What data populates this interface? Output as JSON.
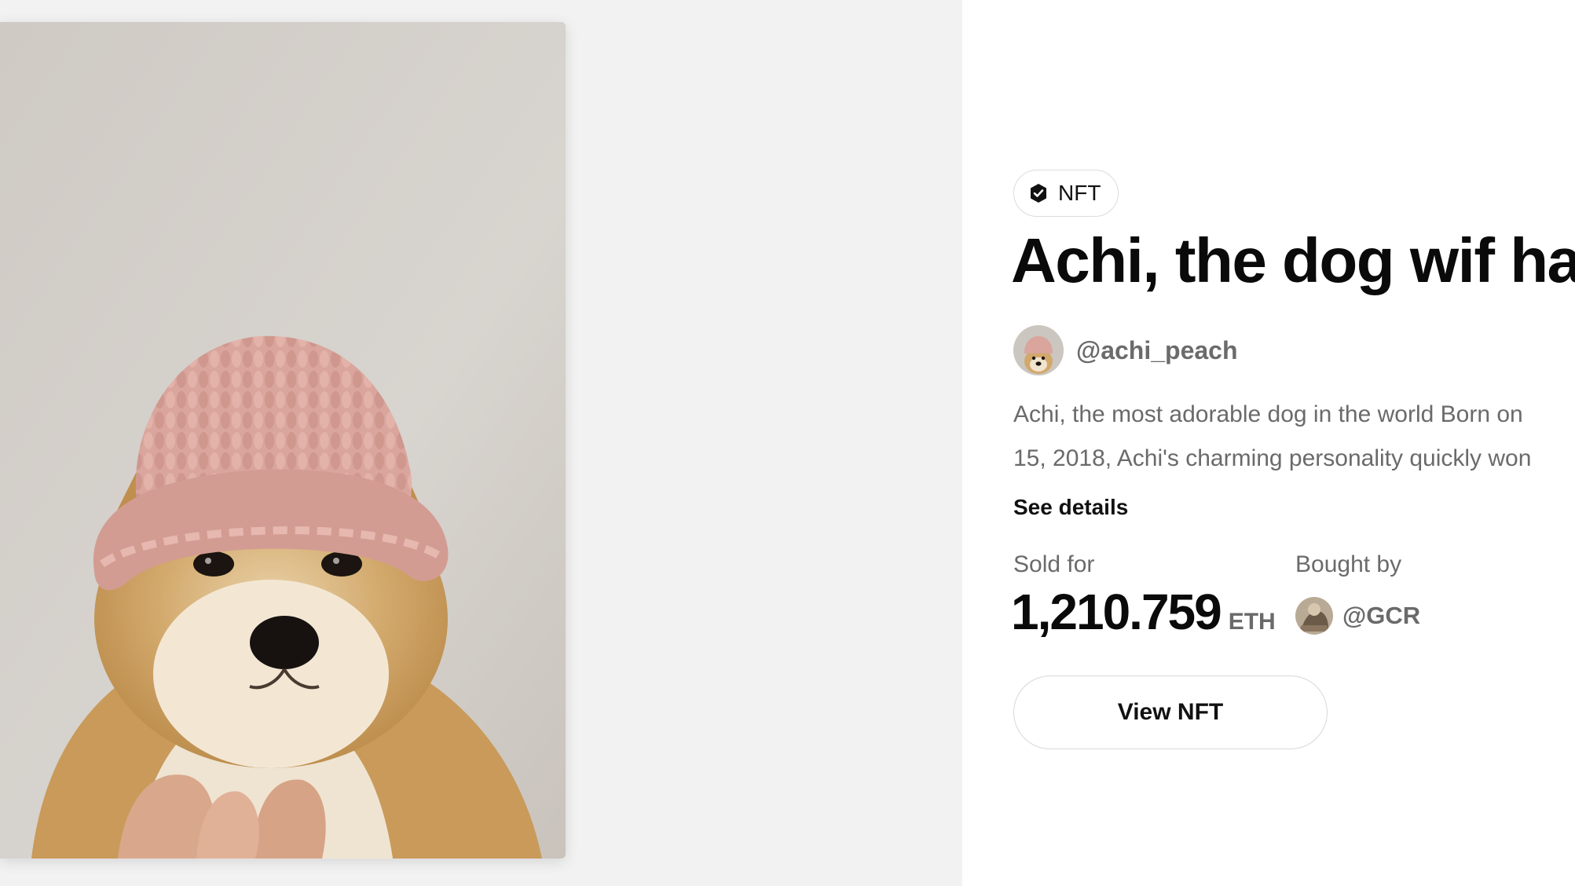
{
  "badge": {
    "label": "NFT",
    "icon": "verified-check-icon"
  },
  "nft": {
    "title": "Achi, the dog wif hat",
    "creator_handle": "@achi_peach",
    "description_lines": [
      "Achi, the most adorable dog in the world Born on",
      "15, 2018, Achi's charming personality quickly won"
    ],
    "see_details_label": "See details"
  },
  "sale": {
    "sold_for_label": "Sold for",
    "price": "1,210.759",
    "currency": "ETH",
    "bought_by_label": "Bought by",
    "buyer_handle": "@GCR"
  },
  "actions": {
    "view_nft_label": "View NFT"
  },
  "colors": {
    "left_bg": "#f2f2f2",
    "right_bg": "#ffffff",
    "muted_text": "#6a6a6a",
    "hat_pink": "#d9a59c"
  }
}
